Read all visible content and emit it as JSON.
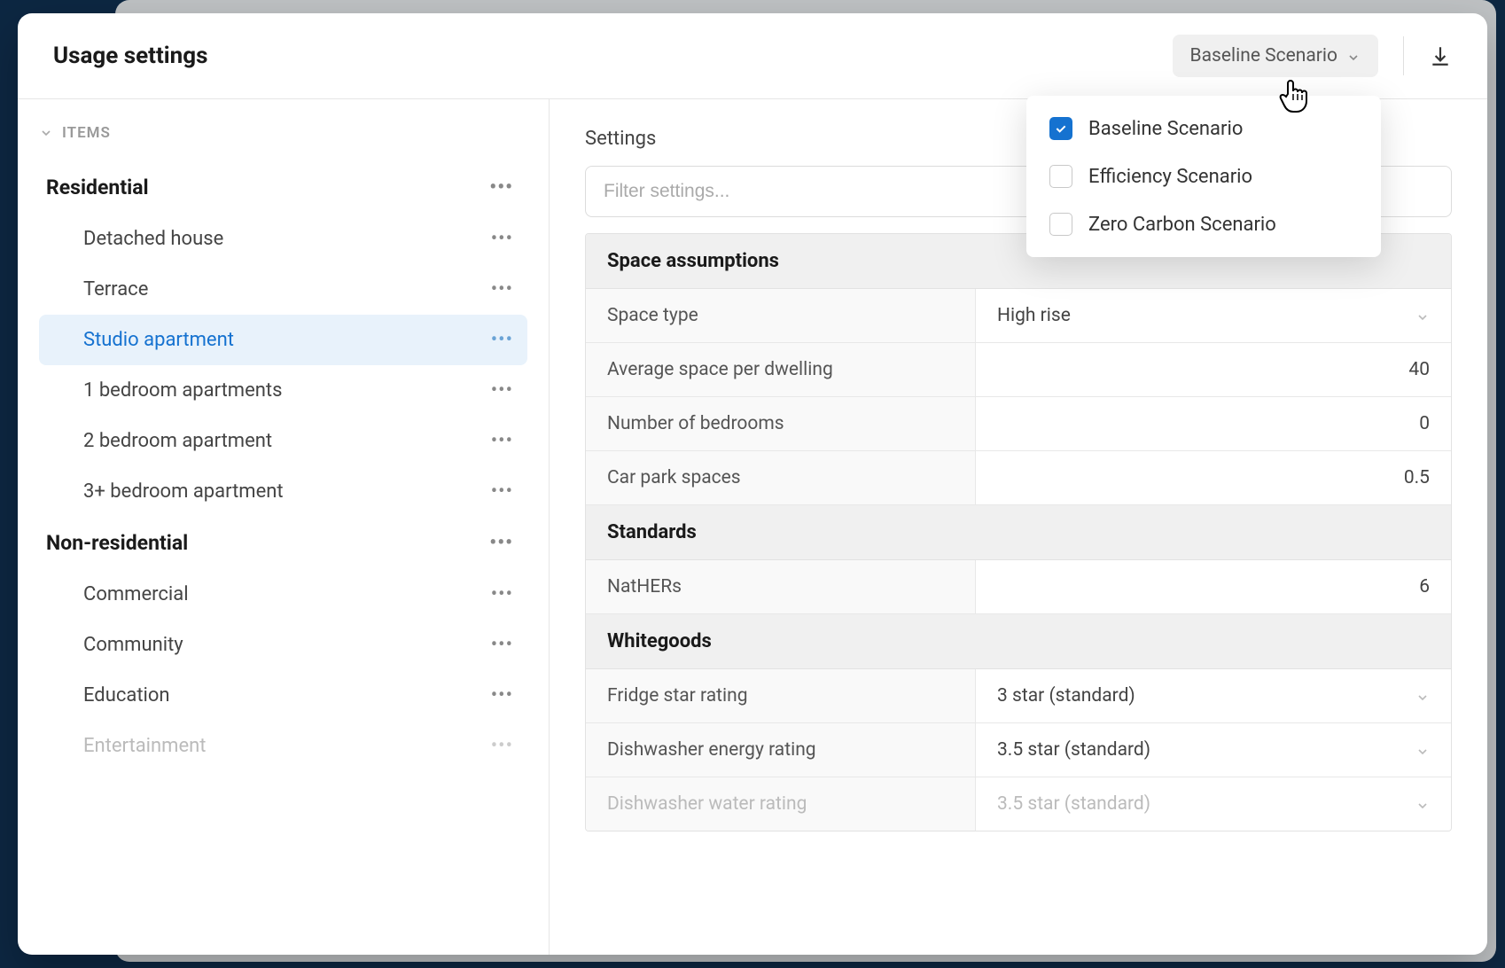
{
  "header": {
    "title": "Usage settings",
    "scenario_label": "Baseline Scenario"
  },
  "sidebar": {
    "items_label": "ITEMS",
    "groups": [
      {
        "label": "Residential",
        "items": [
          {
            "label": "Detached house"
          },
          {
            "label": "Terrace"
          },
          {
            "label": "Studio apartment"
          },
          {
            "label": "1 bedroom apartments"
          },
          {
            "label": "2 bedroom apartment"
          },
          {
            "label": "3+ bedroom apartment"
          }
        ]
      },
      {
        "label": "Non-residential",
        "items": [
          {
            "label": "Commercial"
          },
          {
            "label": "Community"
          },
          {
            "label": "Education"
          },
          {
            "label": "Entertainment"
          }
        ]
      }
    ]
  },
  "main": {
    "settings_title": "Settings",
    "filter_placeholder": "Filter settings...",
    "sections": [
      {
        "title": "Space assumptions"
      },
      {
        "title": "Standards"
      },
      {
        "title": "Whitegoods"
      }
    ],
    "rows": {
      "space_type_label": "Space type",
      "space_type_value": "High rise",
      "avg_space_label": "Average space per dwelling",
      "avg_space_value": "40",
      "bedrooms_label": "Number of bedrooms",
      "bedrooms_value": "0",
      "carpark_label": "Car park spaces",
      "carpark_value": "0.5",
      "nathers_label": "NatHERs",
      "nathers_value": "6",
      "fridge_label": "Fridge star rating",
      "fridge_value": "3 star (standard)",
      "dish_energy_label": "Dishwasher energy rating",
      "dish_energy_value": "3.5 star (standard)",
      "dish_water_label": "Dishwasher water rating",
      "dish_water_value": "3.5 star (standard)"
    }
  },
  "dropdown": {
    "opt1": "Baseline Scenario",
    "opt2": "Efficiency Scenario",
    "opt3": "Zero Carbon Scenario"
  }
}
